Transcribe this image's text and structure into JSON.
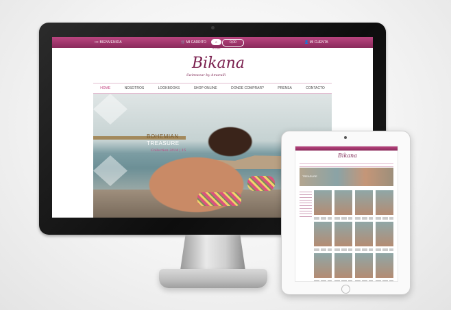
{
  "site": {
    "topbar": {
      "welcome": "••• BIENVENIDA",
      "cart_label": "MI CARRITO",
      "cart_badge": "0 ITEMS",
      "cart_total": "0,00",
      "account_label": "MI CUENTA"
    },
    "brand": {
      "name": "Bikana",
      "tagline": "Swimwear by Amaralli"
    },
    "nav": [
      "HOME",
      "NOSOTROS",
      "LOOKBOOKS",
      "SHOP ONLINE",
      "DONDE COMPRAR?",
      "PRENSA",
      "CONTACTO"
    ],
    "hero": {
      "line1": "BOHEMIAN",
      "line2": "TREASURE",
      "line3": "Collection 2014 | 15"
    }
  },
  "tablet": {
    "brand": "Bikana",
    "banner_text": "TREASURE"
  },
  "colors": {
    "brand": "#8a2a5b",
    "accent": "#c2407f"
  }
}
